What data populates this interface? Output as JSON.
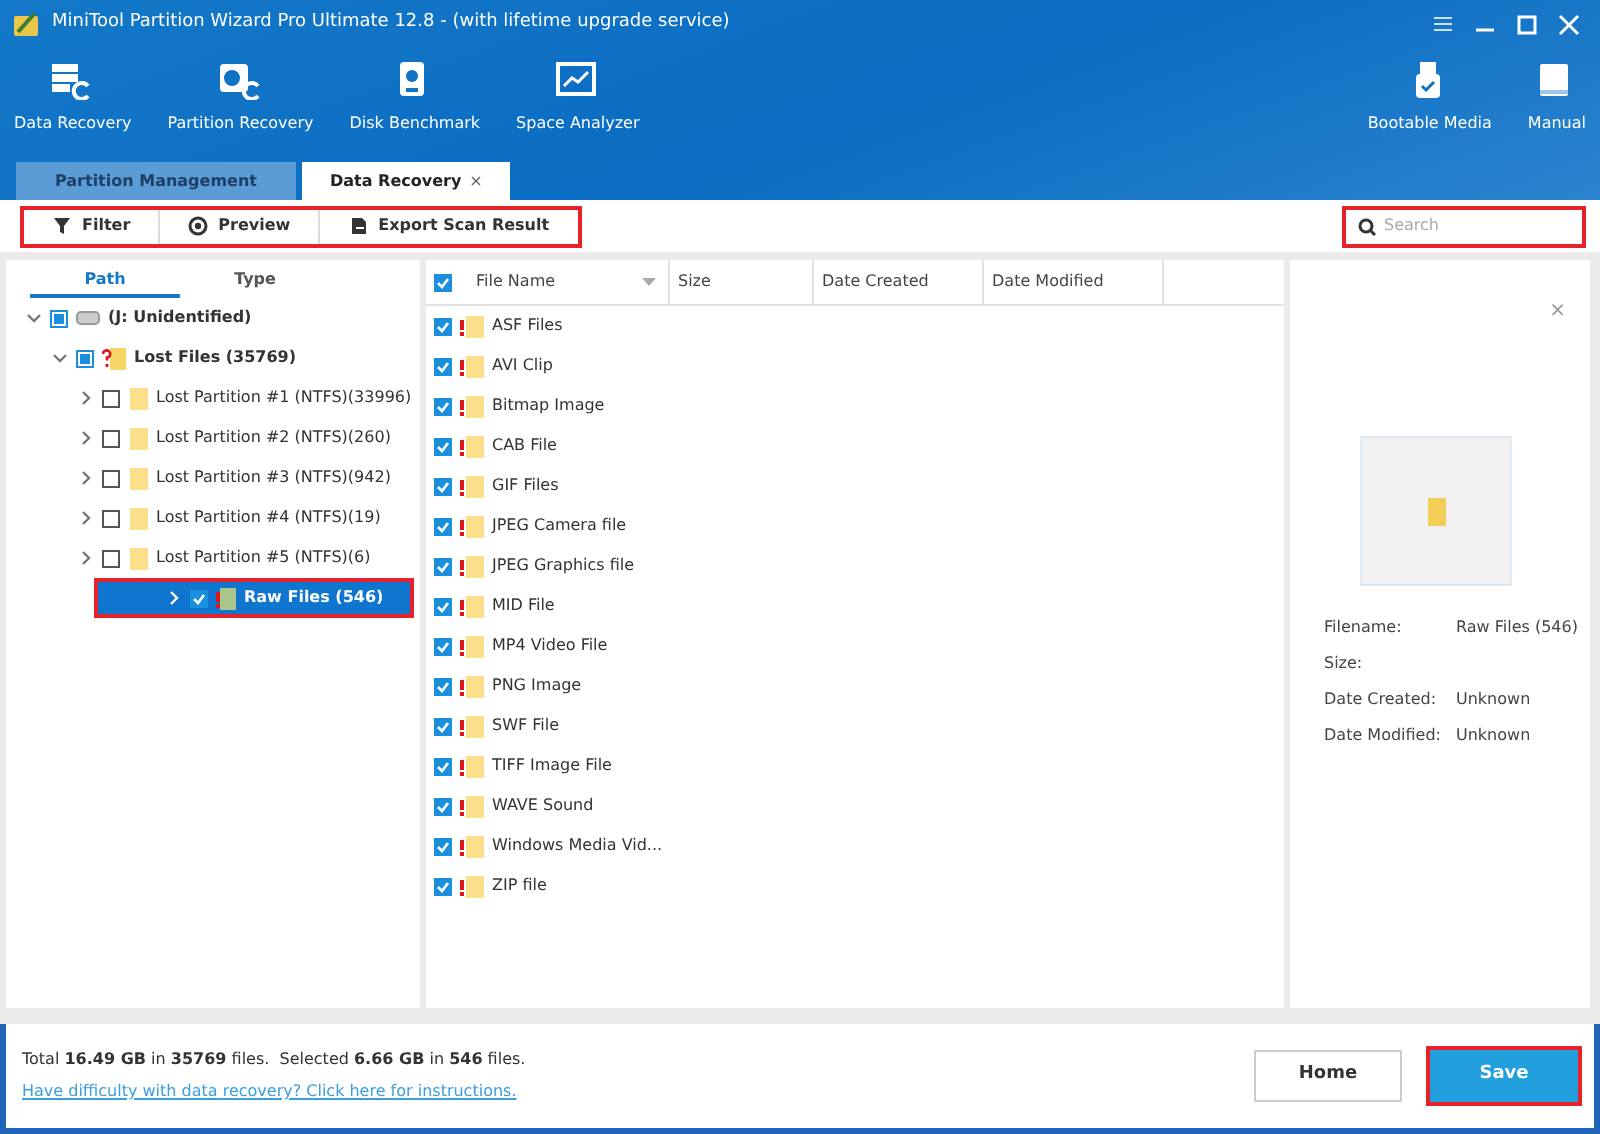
{
  "window": {
    "title": "MiniTool Partition Wizard Pro Ultimate 12.8 - (with lifetime upgrade service)"
  },
  "toolbar": {
    "left": [
      {
        "label": "Data Recovery",
        "kind": "recovery"
      },
      {
        "label": "Partition Recovery",
        "kind": "partition"
      },
      {
        "label": "Disk Benchmark",
        "kind": "benchmark"
      },
      {
        "label": "Space Analyzer",
        "kind": "analyzer"
      }
    ],
    "right": [
      {
        "label": "Bootable Media",
        "kind": "usb"
      },
      {
        "label": "Manual",
        "kind": "book"
      }
    ]
  },
  "tabs": [
    {
      "label": "Partition Management",
      "selected": false
    },
    {
      "label": "Data Recovery",
      "selected": true,
      "close": "×"
    }
  ],
  "actions": {
    "highlighted": true,
    "buttons": [
      {
        "label": "Filter",
        "kind": "filter"
      },
      {
        "label": "Preview",
        "kind": "eye"
      },
      {
        "label": "Export Scan Result",
        "kind": "export"
      }
    ]
  },
  "search": {
    "placeholder": "Search",
    "highlighted": true
  },
  "view_tabs": [
    {
      "label": "Path",
      "selected": true
    },
    {
      "label": "Type",
      "selected": false
    }
  ],
  "tree": [
    {
      "label": "(J: Unidentified)",
      "kind": "drive",
      "checked": true,
      "partial": true,
      "expanded": true,
      "selected": false,
      "children": [
        {
          "label": "Lost Files (35769)",
          "kind": "lost",
          "checked": true,
          "partial": true,
          "expanded": true,
          "selected": false,
          "children": [
            {
              "label": "Lost Partition #1 (NTFS)(33996)",
              "kind": "folder",
              "checked": false,
              "expanded": false,
              "selected": false
            },
            {
              "label": "Lost Partition #2 (NTFS)(260)",
              "kind": "folder",
              "checked": false,
              "expanded": false,
              "selected": false
            },
            {
              "label": "Lost Partition #3 (NTFS)(942)",
              "kind": "folder",
              "checked": false,
              "expanded": false,
              "selected": false
            },
            {
              "label": "Lost Partition #4 (NTFS)(19)",
              "kind": "folder",
              "checked": false,
              "expanded": false,
              "selected": false
            },
            {
              "label": "Lost Partition #5 (NTFS)(6)",
              "kind": "folder",
              "checked": false,
              "expanded": false,
              "selected": false
            },
            {
              "label": "Raw Files (546)",
              "kind": "raw",
              "checked": true,
              "expanded": false,
              "selected": true,
              "highlighted": true
            }
          ]
        }
      ]
    }
  ],
  "file_table": {
    "all_checked": true,
    "columns": [
      "File Name",
      "Size",
      "Date Created",
      "Date Modified"
    ],
    "rows": [
      {
        "name": "ASF Files",
        "checked": true
      },
      {
        "name": "AVI Clip",
        "checked": true
      },
      {
        "name": "Bitmap Image",
        "checked": true
      },
      {
        "name": "CAB File",
        "checked": true
      },
      {
        "name": "GIF Files",
        "checked": true
      },
      {
        "name": "JPEG Camera file",
        "checked": true
      },
      {
        "name": "JPEG Graphics file",
        "checked": true
      },
      {
        "name": "MID File",
        "checked": true
      },
      {
        "name": "MP4 Video File",
        "checked": true
      },
      {
        "name": "PNG Image",
        "checked": true
      },
      {
        "name": "SWF File",
        "checked": true
      },
      {
        "name": "TIFF Image File",
        "checked": true
      },
      {
        "name": "WAVE Sound",
        "checked": true
      },
      {
        "name": "Windows Media Vid...",
        "checked": true
      },
      {
        "name": "ZIP file",
        "checked": true
      }
    ]
  },
  "preview": {
    "close": "×",
    "details": [
      {
        "label": "Filename:",
        "value": "Raw Files (546)"
      },
      {
        "label": "Size:"
      },
      {
        "label": "Date Created:",
        "value": "Unknown"
      },
      {
        "label": "Date Modified:",
        "value": "Unknown"
      }
    ]
  },
  "footer": {
    "summary": "Total **16.49 GB** in **35769** files.  Selected **6.66 GB** in **546** files.",
    "help_link": "Have difficulty with data recovery? Click here for instructions.",
    "buttons": [
      {
        "label": "Home",
        "kind": "secondary",
        "highlighted": false
      },
      {
        "label": "Save",
        "kind": "primary",
        "highlighted": true
      }
    ]
  }
}
